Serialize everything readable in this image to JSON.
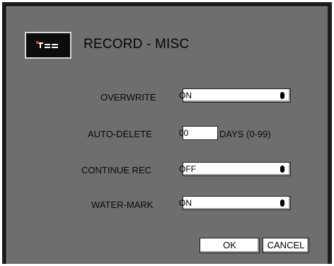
{
  "dialog": {
    "title": "RECORD - MISC",
    "icon": "rec-icon"
  },
  "fields": {
    "overwrite": {
      "label": "OVERWRITE",
      "value": "ON"
    },
    "auto_delete": {
      "label": "AUTO-DELETE",
      "value": "00",
      "suffix": "DAYS (0-99)"
    },
    "continue_rec": {
      "label": "CONTINUE REC",
      "value": "OFF"
    },
    "water_mark": {
      "label": "WATER-MARK",
      "value": "ON"
    }
  },
  "buttons": {
    "ok": "OK",
    "cancel": "CANCEL"
  }
}
